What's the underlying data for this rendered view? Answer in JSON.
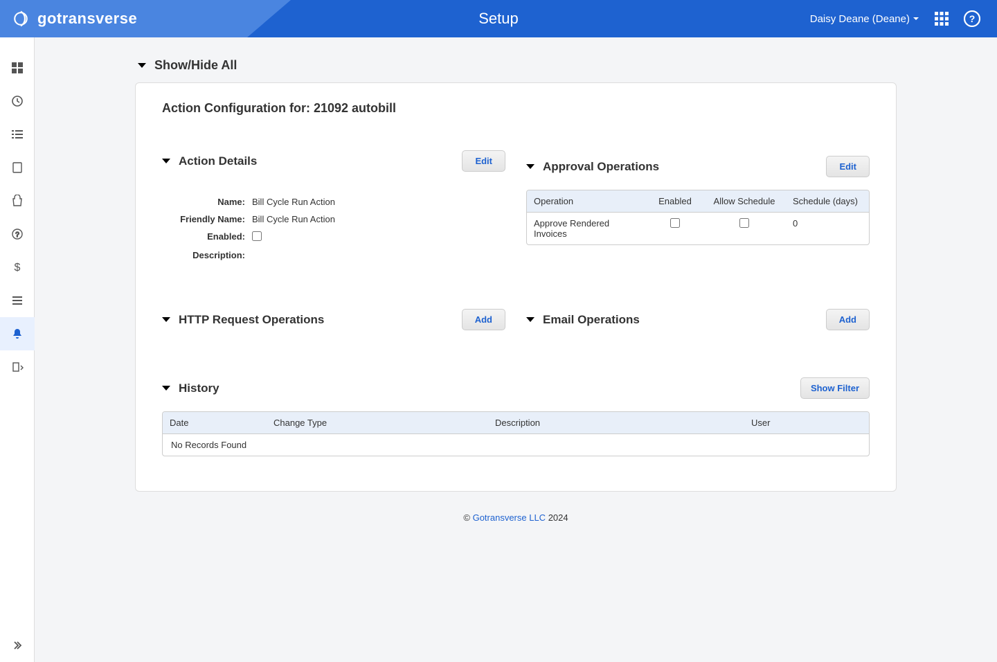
{
  "header": {
    "brand": "gotransverse",
    "title": "Setup",
    "user_label": "Daisy Deane (Deane)"
  },
  "showhide_label": "Show/Hide All",
  "card_title": "Action Configuration for: 21092 autobill",
  "action_details": {
    "section_label": "Action Details",
    "edit_label": "Edit",
    "labels": {
      "name": "Name:",
      "friendly": "Friendly Name:",
      "enabled": "Enabled:",
      "description": "Description:"
    },
    "values": {
      "name": "Bill Cycle Run Action",
      "friendly": "Bill Cycle Run Action",
      "enabled": false,
      "description": ""
    }
  },
  "approval": {
    "section_label": "Approval Operations",
    "edit_label": "Edit",
    "headers": {
      "operation": "Operation",
      "enabled": "Enabled",
      "allow": "Allow Schedule",
      "schedule": "Schedule (days)"
    },
    "rows": [
      {
        "operation": "Approve Rendered Invoices",
        "enabled": false,
        "allow": false,
        "schedule": "0"
      }
    ]
  },
  "http_ops": {
    "section_label": "HTTP Request Operations",
    "add_label": "Add"
  },
  "email_ops": {
    "section_label": "Email Operations",
    "add_label": "Add"
  },
  "history": {
    "section_label": "History",
    "filter_label": "Show Filter",
    "headers": {
      "date": "Date",
      "change": "Change Type",
      "desc": "Description",
      "user": "User"
    },
    "empty": "No Records Found"
  },
  "footer": {
    "copy": "©",
    "link": "Gotransverse LLC",
    "year": "2024"
  }
}
